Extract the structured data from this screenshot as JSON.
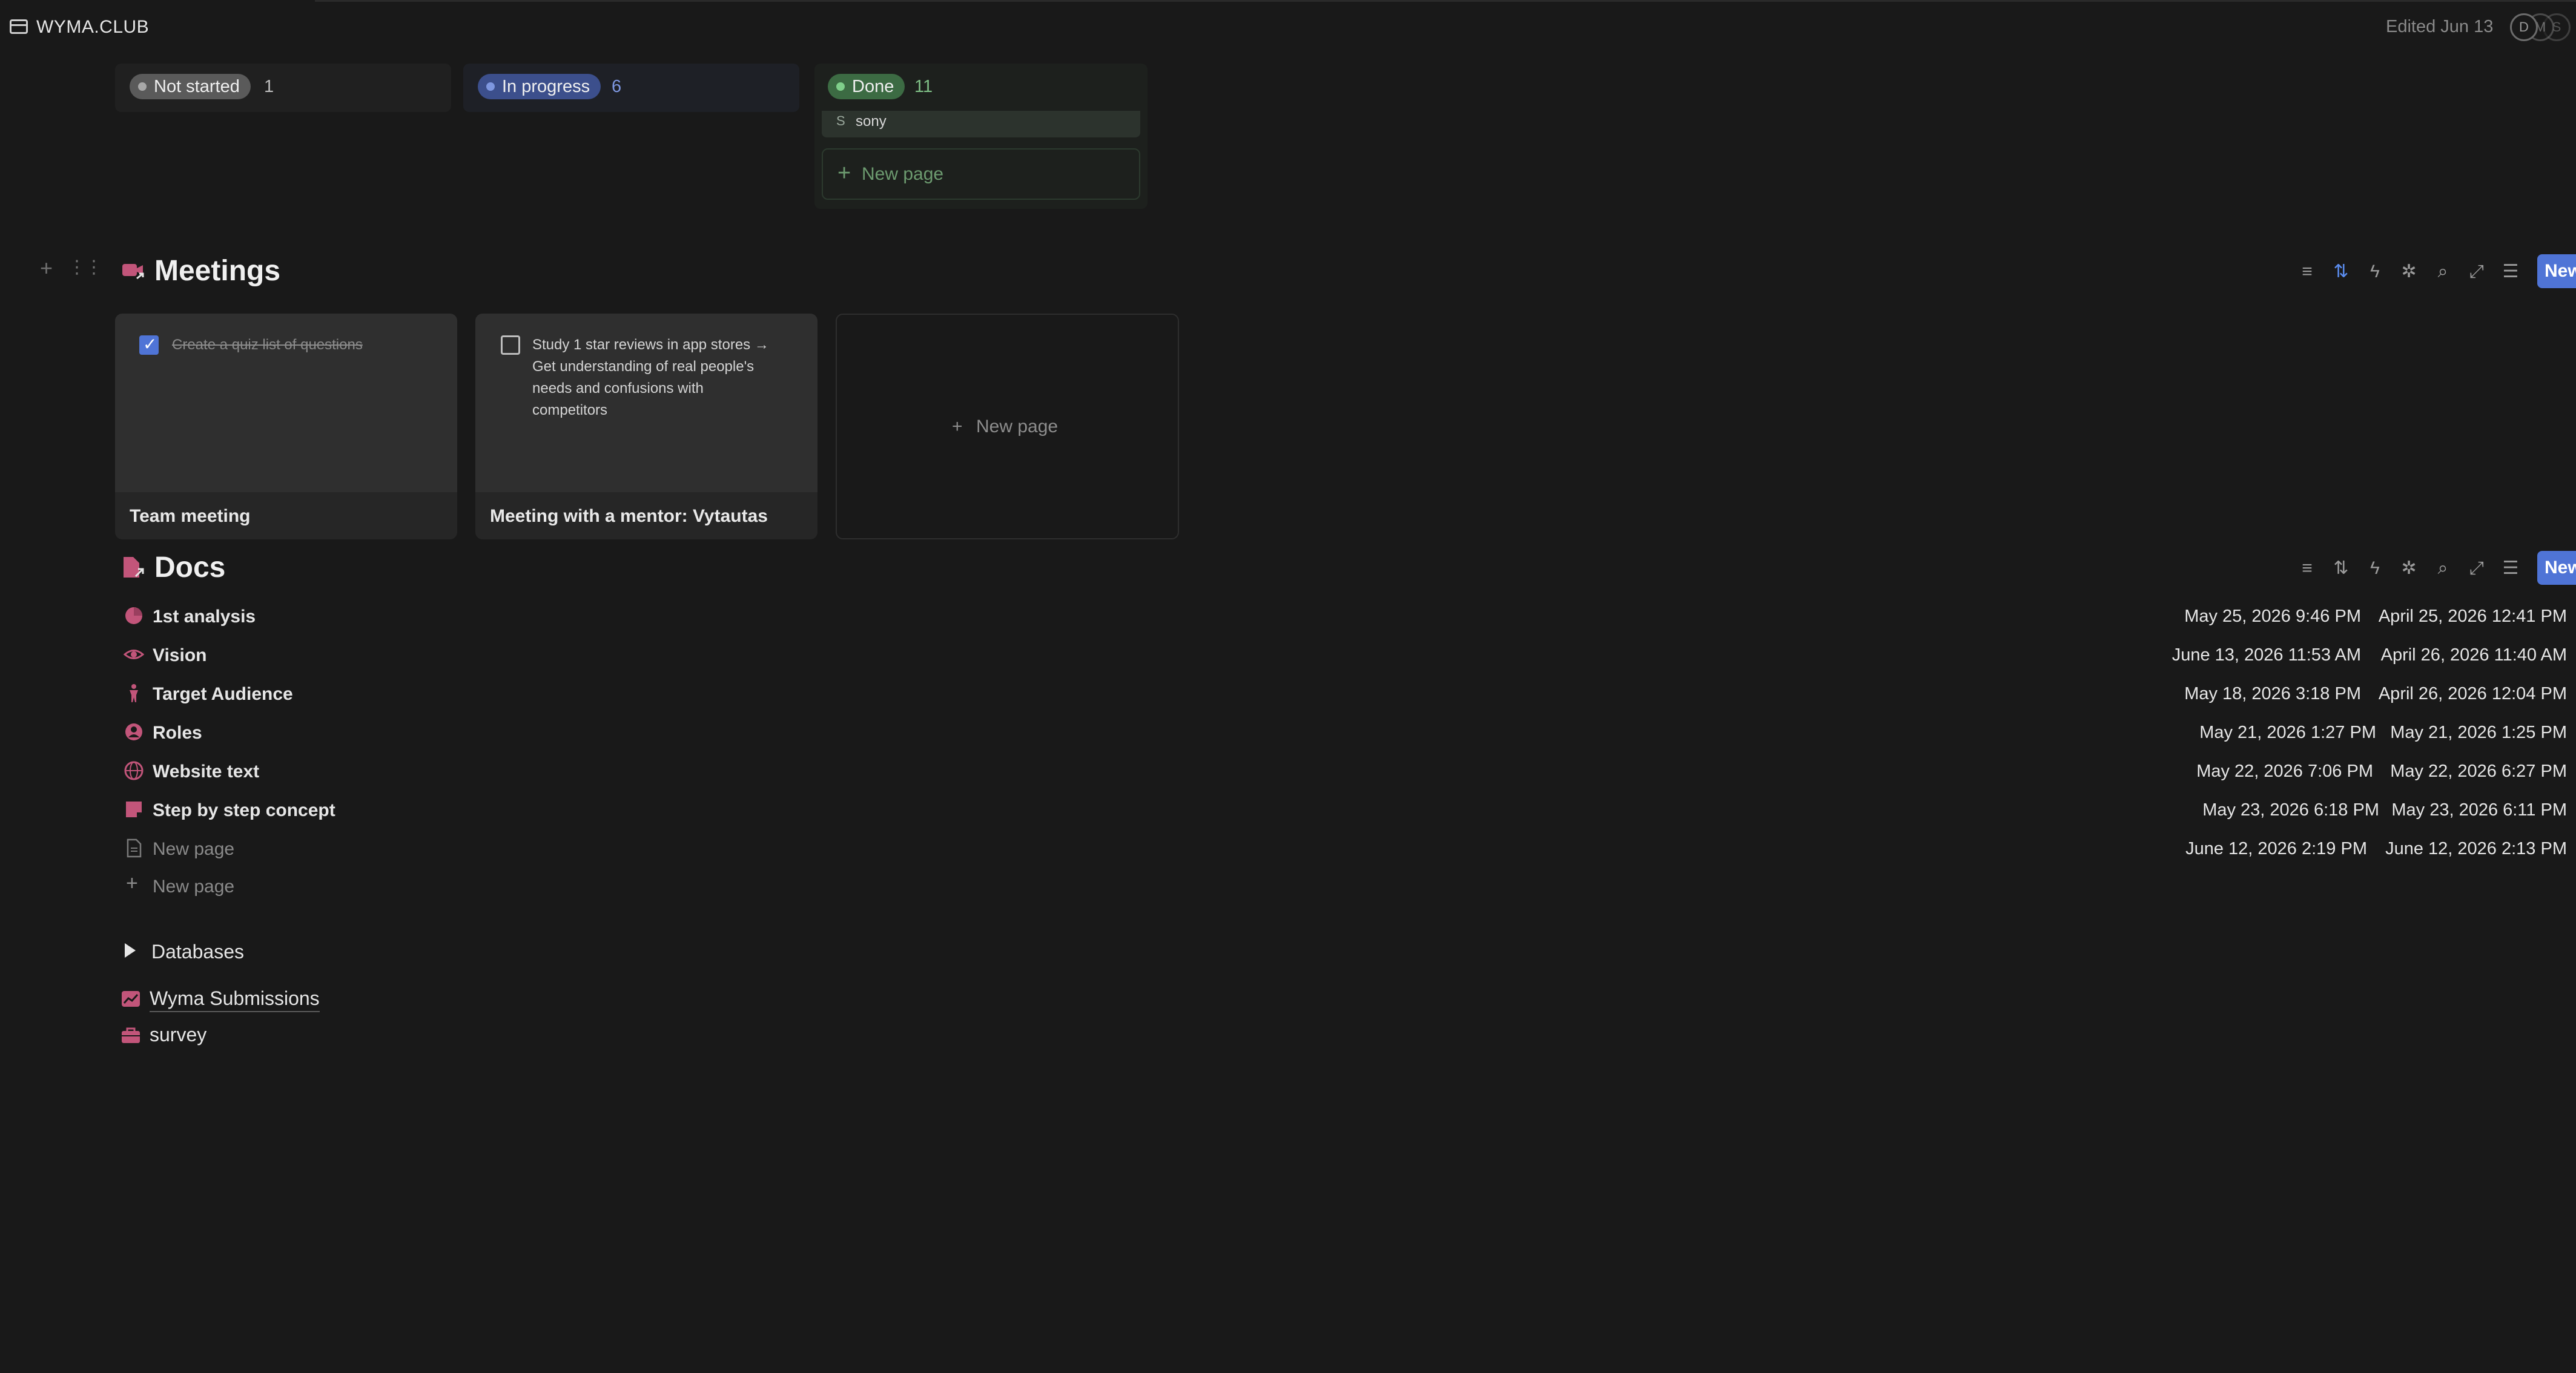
{
  "topbar": {
    "workspace_title": "WYMA.CLUB",
    "edited": "Edited Jun 13",
    "avatars": [
      "D",
      "M",
      "S"
    ]
  },
  "board": {
    "columns": [
      {
        "label": "Not started",
        "count": "1",
        "color": "#8b8b8b"
      },
      {
        "label": "In progress",
        "count": "6",
        "color": "#4a61b3"
      },
      {
        "label": "Done",
        "count": "11",
        "color": "#4f8a59"
      }
    ],
    "done_card": {
      "initial": "S",
      "title": "sony"
    },
    "new_page": "New page"
  },
  "meetings": {
    "title": "Meetings",
    "new_button": "New",
    "cards": [
      {
        "title": "Team meeting",
        "todo": "Create a quiz list of questions",
        "checked": true
      },
      {
        "title": "Meeting with a mentor: Vytautas",
        "todo_lines": [
          "Study 1 star reviews in app stores →",
          "Get understanding of real people's",
          "needs and confusions with",
          "competitors"
        ],
        "checked": false
      }
    ],
    "new_page": "New page"
  },
  "docs": {
    "title": "Docs",
    "new_button": "New",
    "rows": [
      {
        "icon": "pie-chart-icon",
        "title": "1st analysis",
        "edited": "May 25, 2026 9:46 PM",
        "created": "April 25, 2026 12:41 PM"
      },
      {
        "icon": "eye-icon",
        "title": "Vision",
        "edited": "June 13, 2026 11:53 AM",
        "created": "April 26, 2026 11:40 AM"
      },
      {
        "icon": "person-icon",
        "title": "Target Audience",
        "edited": "May 18, 2026 3:18 PM",
        "created": "April 26, 2026 12:04 PM"
      },
      {
        "icon": "user-circle-icon",
        "title": "Roles",
        "edited": "May 21, 2026 1:27 PM",
        "created": "May 21, 2026 1:25 PM"
      },
      {
        "icon": "globe-icon",
        "title": "Website text",
        "edited": "May 22, 2026 7:06 PM",
        "created": "May 22, 2026 6:27 PM"
      },
      {
        "icon": "note-icon",
        "title": "Step by step concept",
        "edited": "May 23, 2026 6:18 PM",
        "created": "May 23, 2026 6:11 PM"
      },
      {
        "icon": "page-icon",
        "title": "New page",
        "edited": "June 12, 2026 2:19 PM",
        "created": "June 12, 2026 2:13 PM"
      }
    ],
    "add_new": "New page"
  },
  "databases": {
    "toggle_label": "Databases",
    "links": [
      {
        "icon": "chart-icon",
        "label": "Wyma Submissions"
      },
      {
        "icon": "briefcase-icon",
        "label": "survey"
      }
    ]
  },
  "colors": {
    "accent": "#4f74d6",
    "icon_pink": "#c2557a"
  }
}
